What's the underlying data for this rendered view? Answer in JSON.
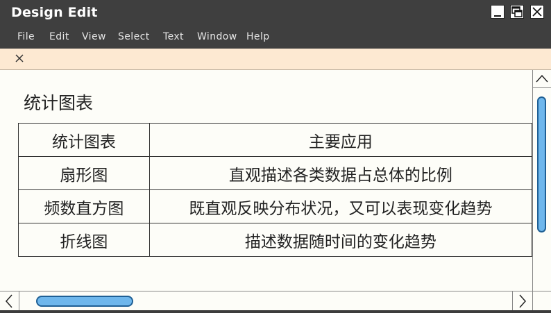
{
  "window": {
    "title": "Design Edit"
  },
  "menu": {
    "items": [
      "File",
      "Edit",
      "View",
      "Select",
      "Text",
      "Window",
      "Help"
    ]
  },
  "document": {
    "heading": "统计图表",
    "table": {
      "header": [
        "统计图表",
        "主要应用"
      ],
      "rows": [
        [
          "扇形图",
          "直观描述各类数据占总体的比例"
        ],
        [
          "频数直方图",
          "既直观反映分布状况，又可以表现变化趋势"
        ],
        [
          "折线图",
          "描述数据随时间的变化趋势"
        ]
      ]
    }
  },
  "scrollbars": {
    "vertical_position": 0.0,
    "horizontal_position": 0.0
  },
  "colors": {
    "titlebar": "#3f3f3f",
    "tabstrip": "#fde9d2",
    "scroll_thumb": "#6fb7ec"
  },
  "icons": [
    "minimize-icon",
    "maximize-icon",
    "close-icon",
    "tab-close-icon",
    "arrow-up-icon",
    "arrow-left-icon",
    "arrow-right-icon"
  ]
}
